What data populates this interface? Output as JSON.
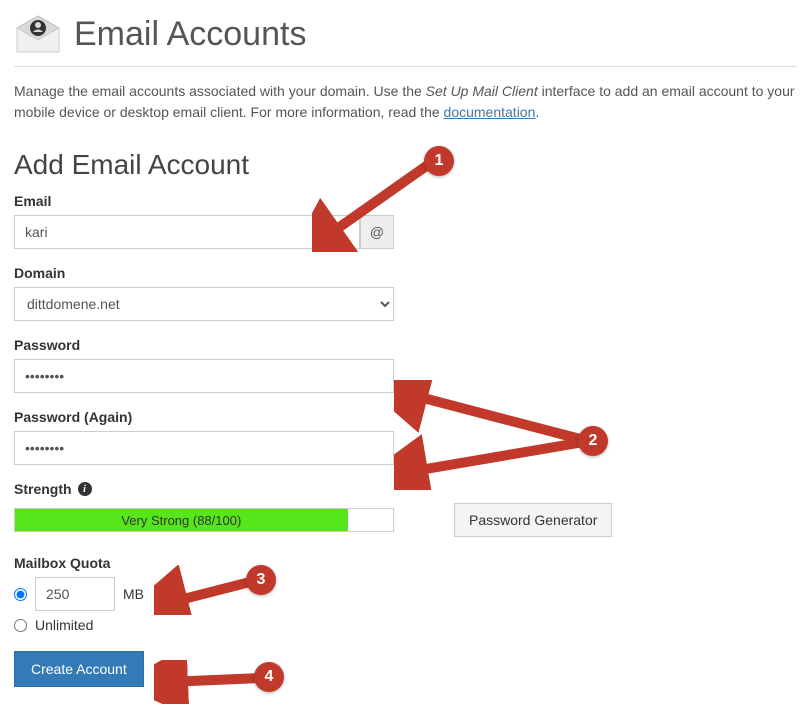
{
  "header": {
    "title": "Email Accounts"
  },
  "intro": {
    "prefix": "Manage the email accounts associated with your domain. Use the ",
    "em": "Set Up Mail Client",
    "mid": " interface to add an email account to your mobile device or desktop email client. For more information, read the ",
    "link": "documentation",
    "suffix": "."
  },
  "section": {
    "title": "Add Email Account"
  },
  "form": {
    "email_label": "Email",
    "email_value": "kari",
    "at": "@",
    "domain_label": "Domain",
    "domain_value": "dittdomene.net",
    "password_label": "Password",
    "password_value": "••••••••",
    "password2_label": "Password (Again)",
    "password2_value": "••••••••",
    "strength_label": "Strength",
    "strength_text": "Very Strong (88/100)",
    "strength_pct": "88",
    "pw_gen_label": "Password Generator",
    "quota_label": "Mailbox Quota",
    "quota_value": "250",
    "quota_unit": "MB",
    "quota_unlimited": "Unlimited",
    "submit_label": "Create Account"
  },
  "annotations": {
    "a1": "1",
    "a2": "2",
    "a3": "3",
    "a4": "4"
  }
}
